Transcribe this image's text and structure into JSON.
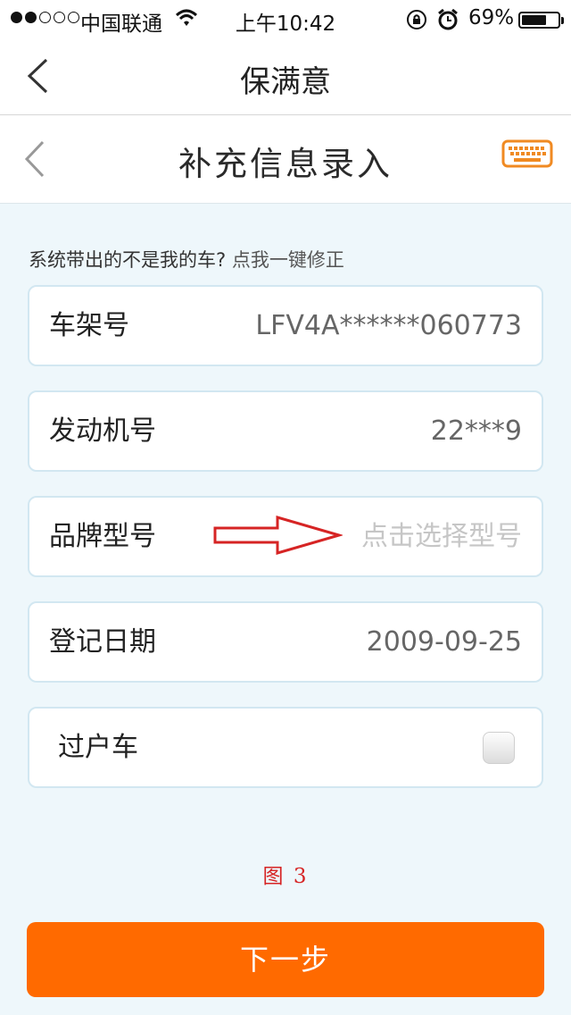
{
  "status_bar": {
    "carrier": "中国联通",
    "time": "上午10:42",
    "battery_percent": "69%",
    "battery_level": 0.69,
    "signal_strength": 2
  },
  "nav": {
    "title": "保满意"
  },
  "page": {
    "title": "补充信息录入"
  },
  "hint": {
    "text": "系统带出的不是我的车?",
    "link": "点我一键修正"
  },
  "fields": [
    {
      "label": "车架号",
      "value": "LFV4A******060773"
    },
    {
      "label": "发动机号",
      "value": "22***9"
    },
    {
      "label": "品牌型号",
      "placeholder": "点击选择型号"
    },
    {
      "label": "登记日期",
      "value": "2009-09-25"
    },
    {
      "label": "过户车",
      "checked": false
    }
  ],
  "figure_caption": "图 3",
  "next_button": {
    "label": "下一步"
  },
  "colors": {
    "accent": "#ff6a00",
    "annotation": "#d62424",
    "background": "#eef7fb",
    "field_border": "#d2e7f1"
  }
}
